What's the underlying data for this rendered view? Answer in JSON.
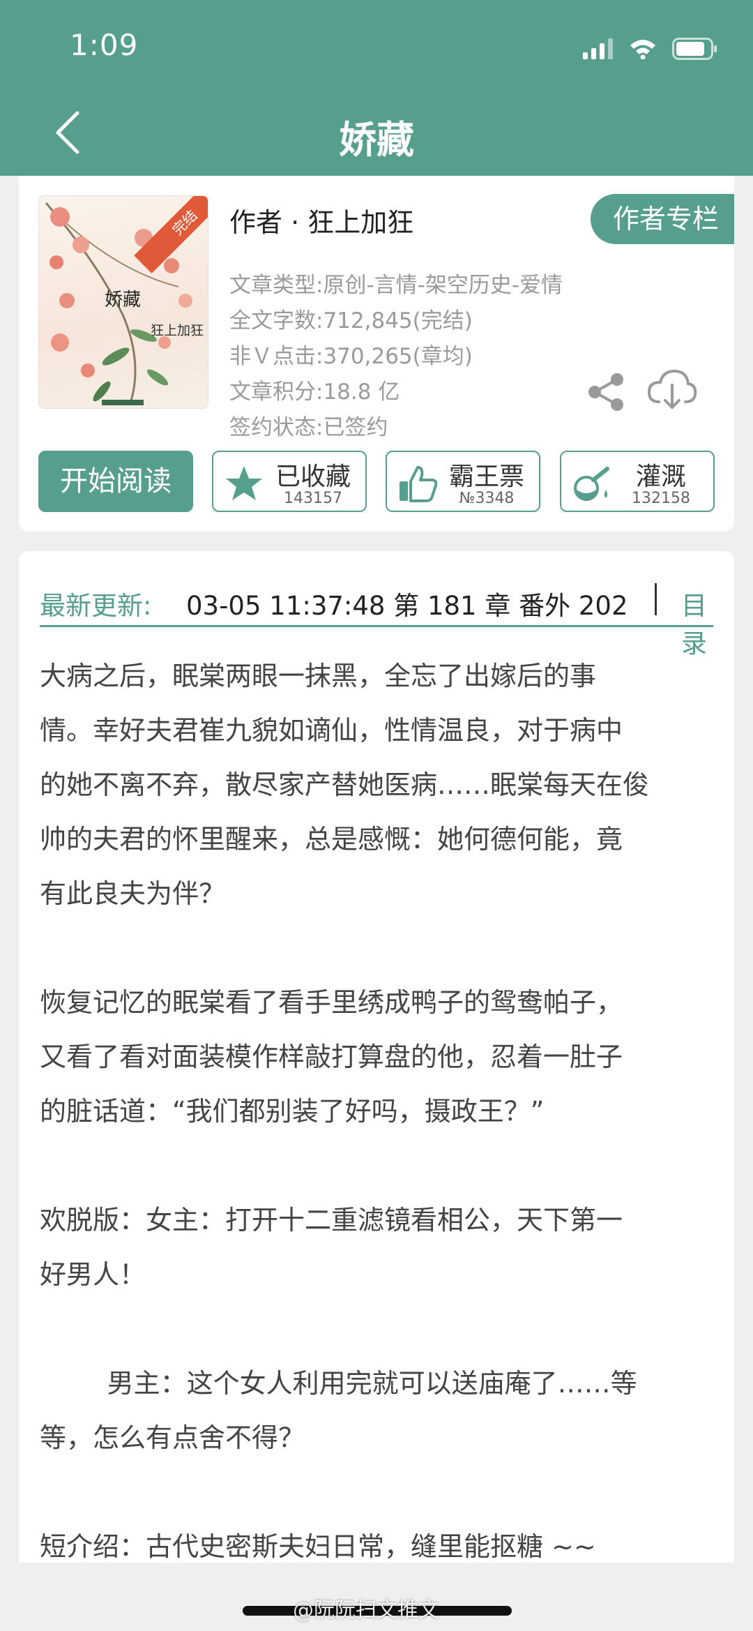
{
  "status_bar": {
    "time": "1:09"
  },
  "nav": {
    "title": "娇藏",
    "back_icon": "chevron-left-icon"
  },
  "book": {
    "cover": {
      "title": "娇藏",
      "author": "狂上加狂",
      "badge": "完结"
    },
    "author_line": "作者 · 狂上加狂",
    "author_column_label": "作者专栏",
    "meta": [
      "文章类型:原创-言情-架空历史-爱情",
      "全文字数:712,845(完结)",
      "非Ｖ点击:370,265(章均)",
      "文章积分:18.8 亿",
      "签约状态:已签约"
    ],
    "read_label": "开始阅读",
    "actions": [
      {
        "label": "已收藏",
        "count": "143157",
        "icon": "star-icon"
      },
      {
        "label": "霸王票",
        "count": "№3348",
        "icon": "thumbs-up-icon"
      },
      {
        "label": "灌溉",
        "count": "132158",
        "icon": "nutrient-bottle-icon"
      }
    ],
    "share_icon": "share-icon",
    "download_icon": "cloud-download-icon"
  },
  "update": {
    "label": "最新更新:",
    "value": "03-05 11:37:48   第 181 章  番外  202",
    "toc_label": "目录"
  },
  "description": [
    "大病之后，眠棠两眼一抹黑，全忘了出嫁后的事",
    "情。幸好夫君崔九貌如谪仙，性情温良，对于病中",
    "的她不离不弃，散尽家产替她医病……眠棠每天在俊",
    "帅的夫君的怀里醒来，总是感慨：她何德何能，竟",
    "有此良夫为伴？",
    "",
    "恢复记忆的眠棠看了看手里绣成鸭子的鸳鸯帕子，",
    "又看了看对面装模作样敲打算盘的他，忍着一肚子",
    "的脏话道：“我们都别装了好吗，摄政王？”",
    "",
    "欢脱版：女主：打开十二重滤镜看相公，天下第一",
    "好男人！",
    "",
    "        男主：这个女人利用完就可以送庙庵了……等",
    "等，怎么有点舍不得？",
    "",
    "短介绍：古代史密斯夫妇日常，缝里能抠糖 ~~"
  ],
  "watermark": "@阮阮扫文推文",
  "colors": {
    "accent": "#569e8d",
    "ribbon": "#e05a3a"
  }
}
